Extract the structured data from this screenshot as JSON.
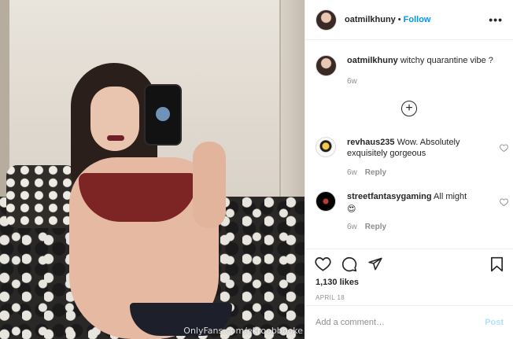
{
  "media": {
    "watermark": "OnlyFans.com/ekroobbooke"
  },
  "header": {
    "username": "oatmilkhuny",
    "separator": "•",
    "follow_label": "Follow",
    "more_label": "•••"
  },
  "caption": {
    "username": "oatmilkhuny",
    "text": "witchy quarantine vibe ?",
    "time": "6w"
  },
  "load_more_label": "+",
  "comments": [
    {
      "username": "revhaus235",
      "text": "Wow. Absolutely exquisitely gorgeous",
      "time": "6w",
      "reply_label": "Reply"
    },
    {
      "username": "streetfantasygaming",
      "text": "All might",
      "emoji": "😍",
      "time": "6w",
      "reply_label": "Reply"
    }
  ],
  "actions": {
    "likes": "1,130 likes",
    "date": "APRIL 18"
  },
  "comment_box": {
    "placeholder": "Add a comment…",
    "post_label": "Post"
  },
  "colors": {
    "link_blue": "#0095f6",
    "post_disabled": "#b2dffc",
    "muted": "#8e8e8e",
    "text": "#262626",
    "border": "#efefef"
  }
}
